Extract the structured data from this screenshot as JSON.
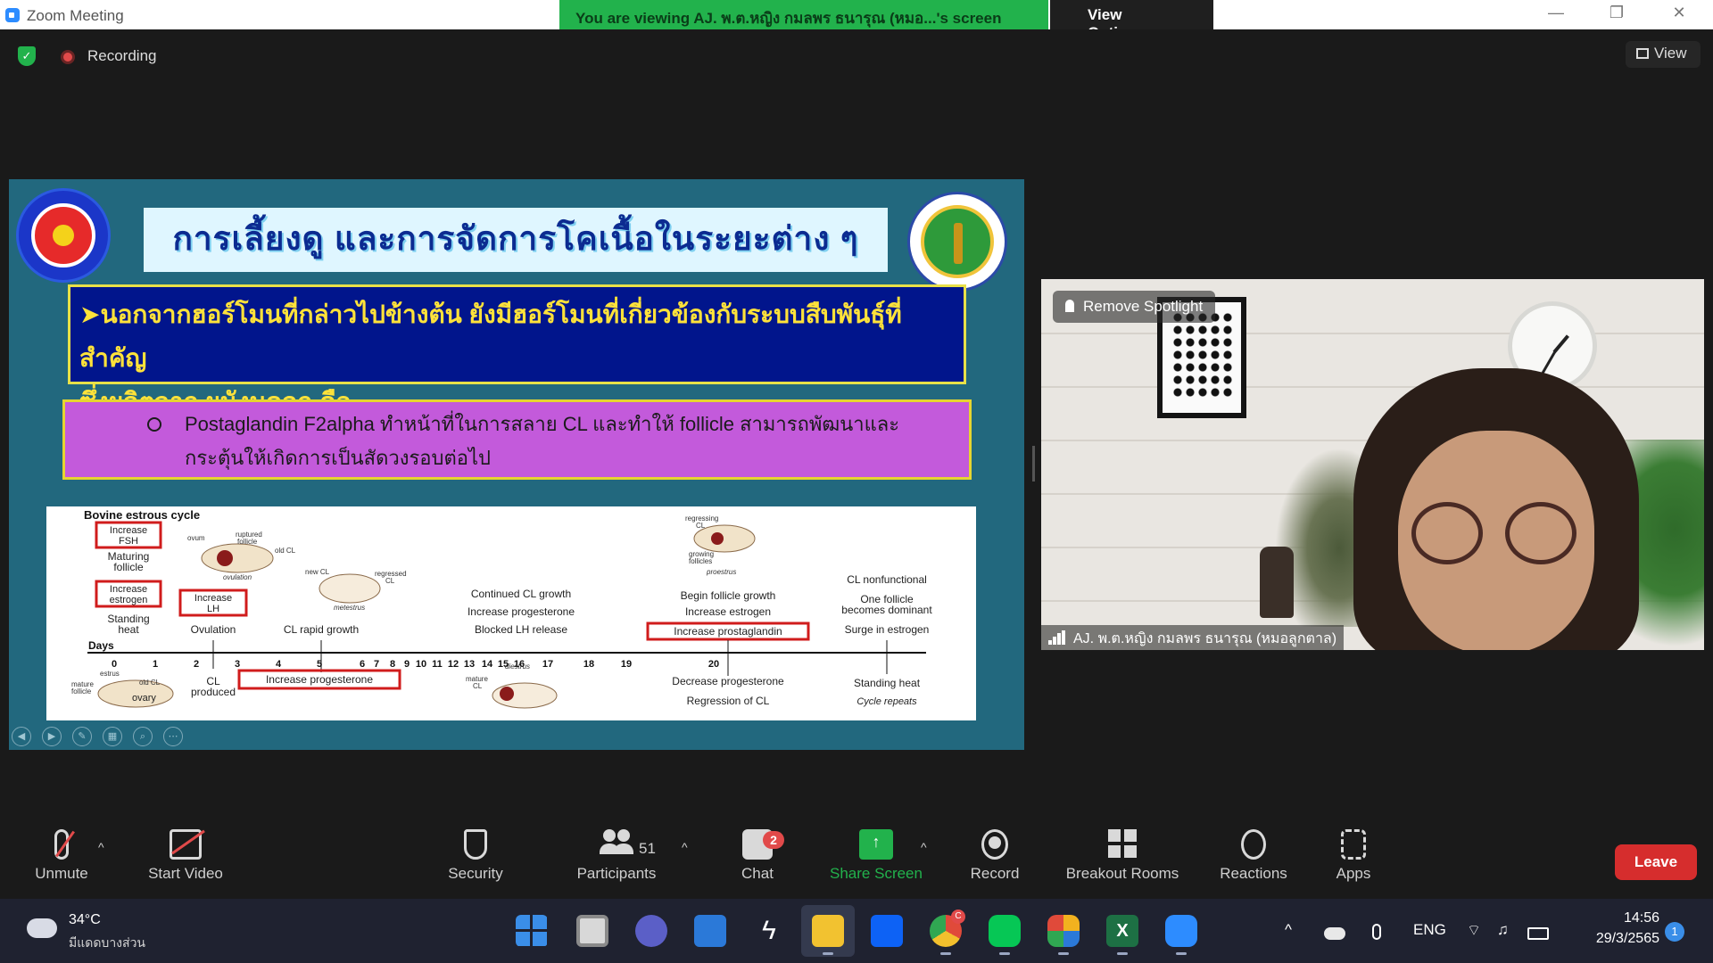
{
  "window": {
    "title": "Zoom Meeting",
    "viewing_banner": "You are viewing AJ. พ.ต.หญิง กมลพร ธนารุณ (หมอ...'s screen",
    "view_options": "View Options ⌄",
    "controls": {
      "minimize": "—",
      "restore": "❐",
      "close": "✕"
    }
  },
  "topbar": {
    "recording_label": "Recording",
    "view_label": "View"
  },
  "slide": {
    "title": "การเลี้ยงดู และการจัดการโคเนื้อในระยะต่าง ๆ",
    "blue_box": {
      "arrow": "➤",
      "line1": "นอกจากฮอร์โมนที่กล่าวไปข้างต้น ยังมีฮอร์โมนที่เกี่ยวข้องกับระบบสืบพันธุ์ที่สำคัญ",
      "line2": "ซึ่งผลิตจาก ผนังมดลูก คือ"
    },
    "purple_box": {
      "line1": "Postaglandin F2alpha ทำหน้าที่ในการสลาย CL และทำให้ follicle สามารถพัฒนาและ",
      "line2": "กระตุ้นให้เกิดการเป็นสัดวงรอบต่อไป"
    },
    "estrous": {
      "title": "Bovine estrous cycle",
      "days_label": "Days",
      "day_ticks": [
        "0",
        "1",
        "2",
        "3",
        "4",
        "5",
        "6",
        "7",
        "8",
        "9",
        "10",
        "11",
        "12",
        "13",
        "14",
        "15",
        "16",
        "17",
        "18",
        "19",
        "20"
      ],
      "boxes": {
        "increase_fsh_1": "Increase",
        "increase_fsh_2": "FSH",
        "increase_estrogen_1": "Increase",
        "increase_estrogen_2": "estrogen",
        "increase_lh_1": "Increase",
        "increase_lh_2": "LH",
        "increase_progesterone": "Increase progesterone",
        "increase_prostaglandin": "Increase prostaglandin"
      },
      "labels": {
        "maturing_1": "Maturing",
        "maturing_2": "follicle",
        "standing_1": "Standing",
        "standing_2": "heat",
        "ovulation": "Ovulation",
        "cl_rapid": "CL rapid growth",
        "continued_cl": "Continued CL growth",
        "inc_prog": "Increase progesterone",
        "blocked_lh": "Blocked LH release",
        "begin_follicle": "Begin follicle growth",
        "inc_estrogen": "Increase estrogen",
        "cl_nonfunctional": "CL nonfunctional",
        "one_follicle_1": "One follicle",
        "one_follicle_2": "becomes dominant",
        "surge_estrogen": "Surge in estrogen",
        "cl_produced_1": "CL",
        "cl_produced_2": "produced",
        "decrease_prog": "Decrease progesterone",
        "regression_cl": "Regression of CL",
        "standing_heat": "Standing heat",
        "cycle_repeats": "Cycle repeats",
        "ovum": "ovum",
        "ruptured_1": "ruptured",
        "ruptured_2": "follicle",
        "old_cl": "old CL",
        "ovulation_small": "ovulation",
        "new_cl": "new CL",
        "regressed_1": "regressed",
        "regressed_2": "CL",
        "metestrus": "metestrus",
        "regressing_1": "regressing",
        "regressing_2": "CL",
        "growing_1": "growing",
        "growing_2": "follicles",
        "proestrus": "proestrus",
        "estrus": "estrus",
        "mature_follicle_1": "mature",
        "mature_follicle_2": "follicle",
        "old_cl_2": "old CL",
        "ovary": "ovary",
        "diestrus": "diestrus",
        "mature_cl_1": "mature",
        "mature_cl_2": "CL"
      }
    },
    "controls": [
      "◀",
      "▶",
      "✎",
      "▦",
      "⌕",
      "⋯"
    ]
  },
  "video": {
    "remove_spotlight": "Remove Spotlight",
    "participant_name": "AJ. พ.ต.หญิง กมลพร ธนารุณ (หมอลูกตาล)"
  },
  "toolbar": {
    "unmute": "Unmute",
    "start_video": "Start Video",
    "security": "Security",
    "participants": "Participants",
    "participants_count": "51",
    "chat": "Chat",
    "chat_badge": "2",
    "share_screen": "Share Screen",
    "record": "Record",
    "breakout_rooms": "Breakout Rooms",
    "reactions": "Reactions",
    "apps": "Apps",
    "leave": "Leave",
    "caret": "^",
    "share_arrow": "↑"
  },
  "taskbar": {
    "temperature": "34°C",
    "weather_desc": "มีแดดบางส่วน",
    "language": "ENG",
    "time": "14:56",
    "date": "29/3/2565",
    "notifications": "1",
    "tray_up": "^",
    "chrome_badge": "C"
  },
  "colors": {
    "zoom_blue": "#2D8CFF",
    "zoom_green": "#22B24C",
    "leave_red": "#D62D2D",
    "badge_red": "#E14A4A"
  }
}
